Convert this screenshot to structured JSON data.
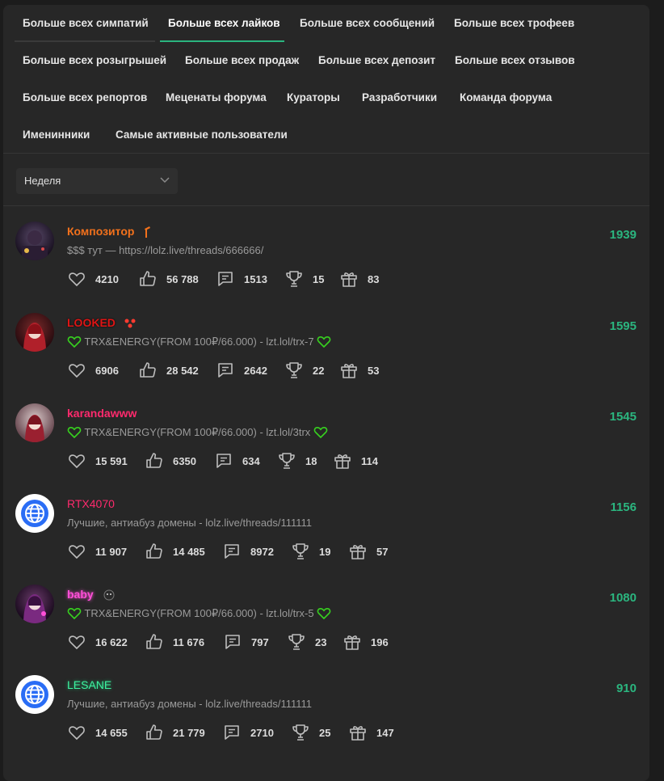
{
  "tabs": [
    {
      "label": "Больше всех симпатий"
    },
    {
      "label": "Больше всех лайков"
    },
    {
      "label": "Больше всех сообщений"
    },
    {
      "label": "Больше всех трофеев"
    },
    {
      "label": "Больше всех розыгрышей"
    },
    {
      "label": "Больше всех продаж"
    },
    {
      "label": "Больше всех депозит"
    },
    {
      "label": "Больше всех отзывов"
    },
    {
      "label": "Больше всех репортов"
    },
    {
      "label": "Меценаты форума"
    },
    {
      "label": "Кураторы"
    },
    {
      "label": "Разработчики"
    },
    {
      "label": "Команда форума"
    },
    {
      "label": "Именинники"
    },
    {
      "label": "Самые активные пользователи"
    }
  ],
  "active_tab": "Больше всех лайков",
  "filter": {
    "period": "Неделя"
  },
  "colors": {
    "accent": "#2bb57f",
    "panel": "#272727",
    "background": "#1c1c1c"
  },
  "users": [
    {
      "name": "Композитор",
      "name_color": "#f2711c",
      "status": "$$$ тут — https://lolz.live/threads/666666/",
      "score": "1939",
      "stats": {
        "sympathies": "4210",
        "likes": "56 788",
        "messages": "1513",
        "trophies": "15",
        "gifts": "83"
      }
    },
    {
      "name": "LOOKED",
      "name_color": "#e01515",
      "status": "TRX&ENERGY(FROM 100₽/66.000) - lzt.lol/trx-7",
      "score": "1595",
      "stats": {
        "sympathies": "6906",
        "likes": "28 542",
        "messages": "2642",
        "trophies": "22",
        "gifts": "53"
      }
    },
    {
      "name": "karandawww",
      "name_color": "#ff2a6d",
      "status": "TRX&ENERGY(FROM 100₽/66.000) - lzt.lol/3trx",
      "score": "1545",
      "stats": {
        "sympathies": "15 591",
        "likes": "6350",
        "messages": "634",
        "trophies": "18",
        "gifts": "114"
      }
    },
    {
      "name": "RTX4070",
      "name_color": "#ff2a6d",
      "status": "Лучшие, антиабуз домены - lolz.live/threads/111111",
      "score": "1156",
      "stats": {
        "sympathies": "11 907",
        "likes": "14 485",
        "messages": "8972",
        "trophies": "19",
        "gifts": "57"
      }
    },
    {
      "name": "baby",
      "name_color": "#ff4fd8",
      "status": "TRX&ENERGY(FROM 100₽/66.000) - lzt.lol/trx-5",
      "score": "1080",
      "stats": {
        "sympathies": "16 622",
        "likes": "11 676",
        "messages": "797",
        "trophies": "23",
        "gifts": "196"
      }
    },
    {
      "name": "LESANE",
      "name_color": "#3df2a0",
      "status": "Лучшие, антиабуз домены - lolz.live/threads/111111",
      "score": "910",
      "stats": {
        "sympathies": "14 655",
        "likes": "21 779",
        "messages": "2710",
        "trophies": "25",
        "gifts": "147"
      }
    }
  ],
  "icons": {
    "sympathies": "heart-icon",
    "likes": "thumbs-up-icon",
    "messages": "message-icon",
    "trophies": "trophy-icon",
    "gifts": "gift-icon"
  }
}
